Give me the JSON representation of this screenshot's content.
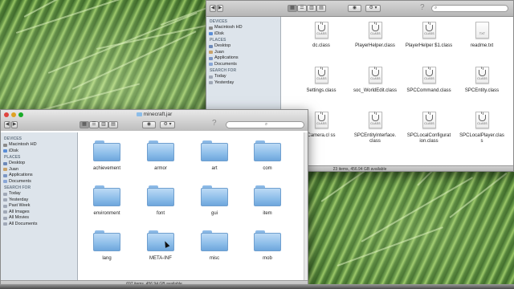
{
  "back_window": {
    "search_placeholder": "",
    "sidebar": [
      {
        "type": "head",
        "label": "DEVICES"
      },
      {
        "type": "item",
        "label": "Macintosh HD",
        "color": "#8a8a8a"
      },
      {
        "type": "item",
        "label": "iDisk",
        "color": "#5b8ed6"
      },
      {
        "type": "head",
        "label": "PLACES"
      },
      {
        "type": "item",
        "label": "Desktop",
        "color": "#6d89b8"
      },
      {
        "type": "item",
        "label": "Juan",
        "color": "#c9a36b"
      },
      {
        "type": "item",
        "label": "Applications",
        "color": "#7b96c4"
      },
      {
        "type": "item",
        "label": "Documents",
        "color": "#8aa7d6"
      },
      {
        "type": "head",
        "label": "SEARCH FOR"
      },
      {
        "type": "item",
        "label": "Today",
        "color": "#a0a8b6"
      },
      {
        "type": "item",
        "label": "Yesterday",
        "color": "#a0a8b6"
      }
    ],
    "files": [
      {
        "name": "dc.class",
        "doc": "CLASS"
      },
      {
        "name": "PlayerHelper.class",
        "doc": "CLASS"
      },
      {
        "name": "PlayerHelper $1.class",
        "doc": "CLASS"
      },
      {
        "name": "readme.txt",
        "doc": "TXT"
      },
      {
        "name": "Settings.class",
        "doc": "CLASS"
      },
      {
        "name": "soc_WorldEdit.class",
        "doc": "CLASS"
      },
      {
        "name": "SPCCommand.class",
        "doc": "CLASS"
      },
      {
        "name": "SPCEntity.class",
        "doc": "CLASS"
      },
      {
        "name": "Camera.cl ss",
        "doc": "CLASS"
      },
      {
        "name": "SPCEntityInterface. class",
        "doc": "CLASS"
      },
      {
        "name": "SPCLocalConfigurat ion.class",
        "doc": "CLASS"
      },
      {
        "name": "SPCLocalPlayer.clas s",
        "doc": "CLASS"
      }
    ],
    "status": "23 items, 456.94 GB available"
  },
  "front_window": {
    "title": "minecraft.jar",
    "search_placeholder": "",
    "sidebar": [
      {
        "type": "head",
        "label": "DEVICES"
      },
      {
        "type": "item",
        "label": "Macintosh HD",
        "color": "#8a8a8a"
      },
      {
        "type": "item",
        "label": "iDisk",
        "color": "#5b8ed6"
      },
      {
        "type": "head",
        "label": "PLACES"
      },
      {
        "type": "item",
        "label": "Desktop",
        "color": "#6d89b8"
      },
      {
        "type": "item",
        "label": "Juan",
        "color": "#c9a36b"
      },
      {
        "type": "item",
        "label": "Applications",
        "color": "#7b96c4"
      },
      {
        "type": "item",
        "label": "Documents",
        "color": "#8aa7d6"
      },
      {
        "type": "head",
        "label": "SEARCH FOR"
      },
      {
        "type": "item",
        "label": "Today",
        "color": "#a0a8b6"
      },
      {
        "type": "item",
        "label": "Yesterday",
        "color": "#a0a8b6"
      },
      {
        "type": "item",
        "label": "Past Week",
        "color": "#a0a8b6"
      },
      {
        "type": "item",
        "label": "All Images",
        "color": "#a0a8b6"
      },
      {
        "type": "item",
        "label": "All Movies",
        "color": "#a0a8b6"
      },
      {
        "type": "item",
        "label": "All Documents",
        "color": "#a0a8b6"
      }
    ],
    "folders": [
      "achievement",
      "armor",
      "art",
      "com",
      "environment",
      "font",
      "gui",
      "item",
      "lang",
      "META-INF",
      "misc",
      "mob"
    ],
    "status": "697 items, 456.94 GB available"
  },
  "colors": {
    "folder": "#8cbde9",
    "sidebar_bg": "#dde4eb"
  }
}
